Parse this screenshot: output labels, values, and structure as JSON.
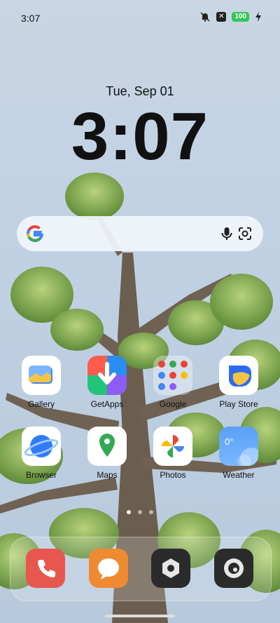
{
  "status_bar": {
    "time": "3:07",
    "battery_level": "100",
    "notification_glyph": "✕",
    "icons": [
      "silent-icon",
      "notification-icon",
      "battery-icon",
      "charging-icon"
    ]
  },
  "clock_widget": {
    "date": "Tue, Sep 01",
    "time": "3:07"
  },
  "search": {
    "icons": [
      "google-g-icon",
      "mic-icon",
      "lens-icon"
    ]
  },
  "apps": [
    {
      "label": "Gallery",
      "icon": "gallery-icon"
    },
    {
      "label": "GetApps",
      "icon": "getapps-icon"
    },
    {
      "label": "Google",
      "icon": "google-folder-icon"
    },
    {
      "label": "Play Store",
      "icon": "play-store-icon"
    },
    {
      "label": "Browser",
      "icon": "browser-icon"
    },
    {
      "label": "Maps",
      "icon": "maps-icon"
    },
    {
      "label": "Photos",
      "icon": "photos-icon"
    },
    {
      "label": "Weather",
      "icon": "weather-icon",
      "badge": "0°"
    }
  ],
  "page_indicator": {
    "pages": 3,
    "active": 1
  },
  "dock": [
    {
      "name": "Phone",
      "icon": "phone-icon"
    },
    {
      "name": "Messages",
      "icon": "messages-icon"
    },
    {
      "name": "Settings",
      "icon": "settings-icon"
    },
    {
      "name": "Camera",
      "icon": "camera-icon"
    }
  ],
  "colors": {
    "sky": "#c9d6e4",
    "battery_green": "#34c759",
    "phone_red": "#e8574e",
    "messages_orange": "#f08a32"
  }
}
